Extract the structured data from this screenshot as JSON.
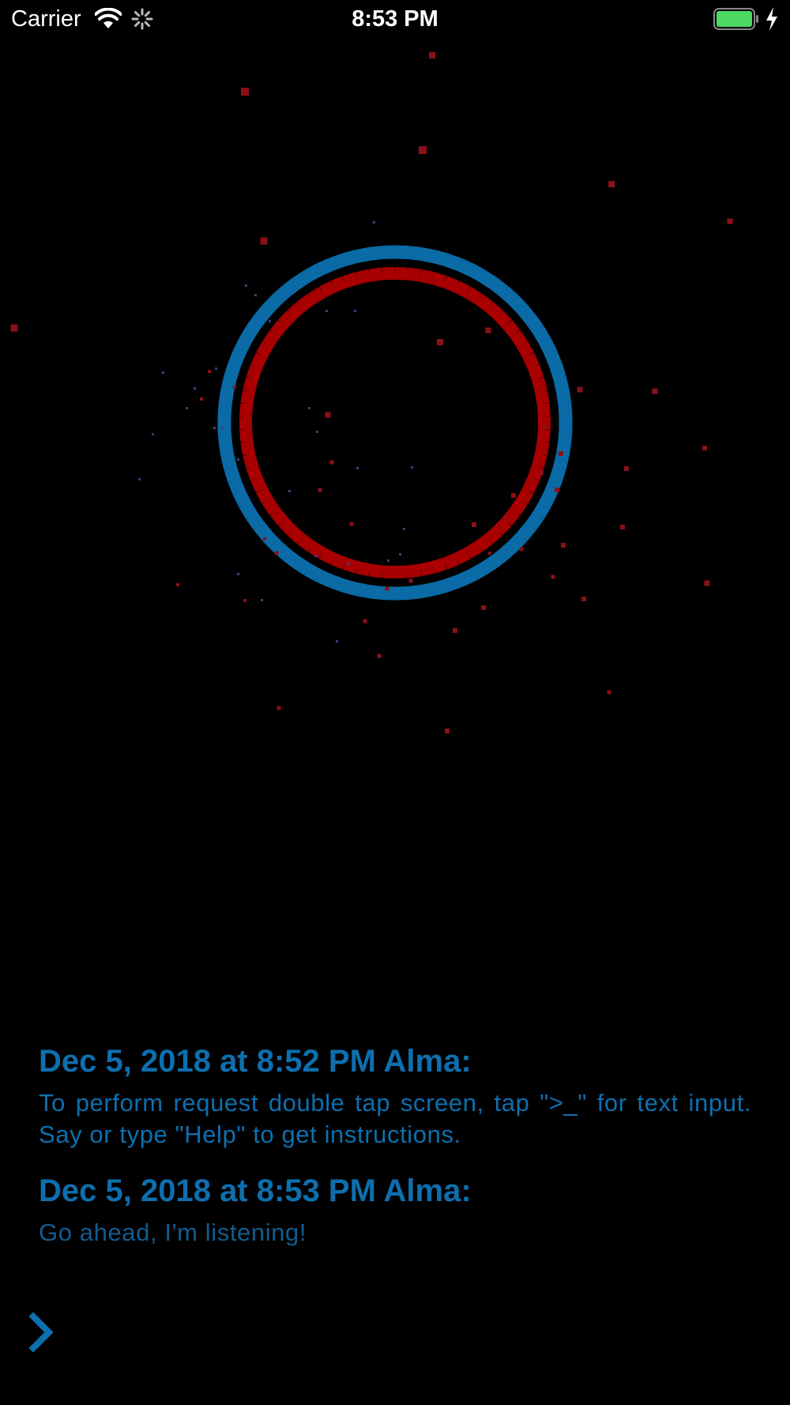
{
  "status_bar": {
    "carrier": "Carrier",
    "time": "8:53 PM",
    "battery_color": "#4cd964"
  },
  "visualizer": {
    "outer_ring_color": "#0a6ba6",
    "inner_ring_color": "#a80000",
    "particle_color": "#8b1018"
  },
  "messages": [
    {
      "header": "Dec 5, 2018 at 8:52 PM Alma:",
      "body": "To perform request double tap screen, tap \">_\" for text input. Say or type \"Help\" to get instructions."
    },
    {
      "header": "Dec 5, 2018 at 8:53 PM Alma:",
      "body": "Go ahead, I'm listening!"
    }
  ],
  "input_toggle": {
    "icon": "chevron-right-icon",
    "color": "#0e6fae"
  }
}
